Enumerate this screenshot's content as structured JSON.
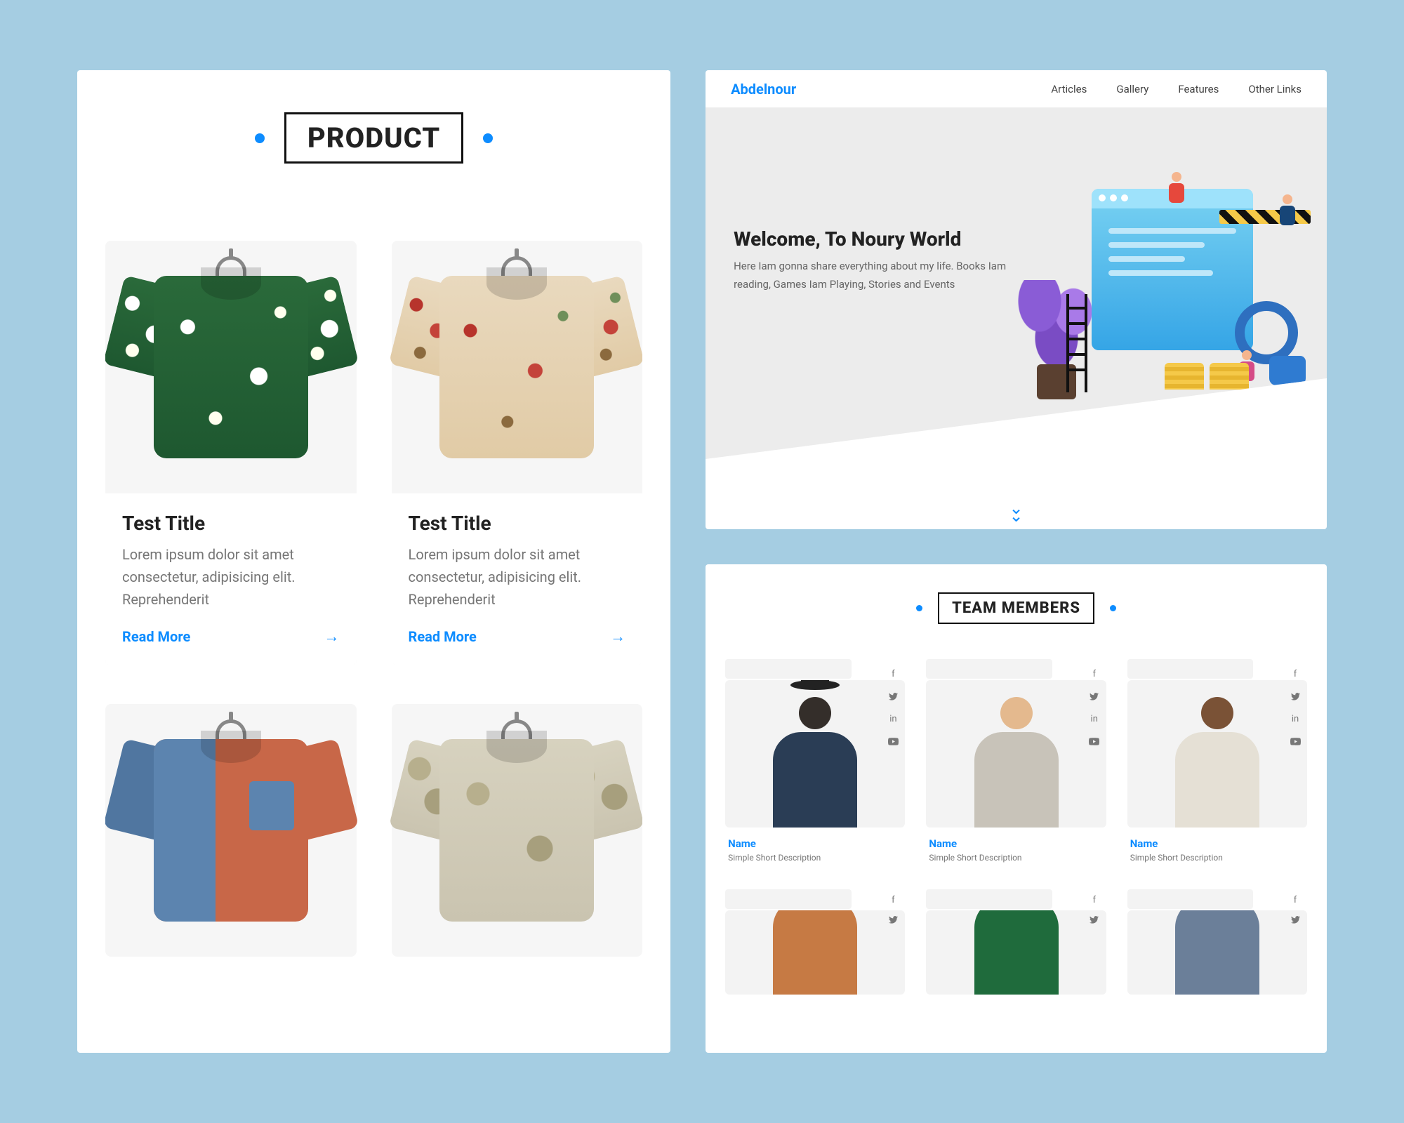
{
  "products": {
    "heading": "PRODUCT",
    "items": [
      {
        "title": "Test Title",
        "desc": "Lorem ipsum dolor sit amet consectetur, adipisicing elit. Reprehenderit",
        "cta": "Read More"
      },
      {
        "title": "Test Title",
        "desc": "Lorem ipsum dolor sit amet consectetur, adipisicing elit. Reprehenderit",
        "cta": "Read More"
      },
      {
        "title": "",
        "desc": "",
        "cta": ""
      },
      {
        "title": "",
        "desc": "",
        "cta": ""
      }
    ]
  },
  "nav": {
    "brand": "Abdelnour",
    "links": [
      "Articles",
      "Gallery",
      "Features",
      "Other Links"
    ]
  },
  "hero": {
    "title": "Welcome, To Noury World",
    "subtitle": "Here Iam gonna share everything about my life. Books Iam reading, Games Iam Playing, Stories and Events"
  },
  "team": {
    "heading": "TEAM MEMBERS",
    "members": [
      {
        "name": "Name",
        "desc": "Simple Short Description"
      },
      {
        "name": "Name",
        "desc": "Simple Short Description"
      },
      {
        "name": "Name",
        "desc": "Simple Short Description"
      },
      {
        "name": "",
        "desc": ""
      },
      {
        "name": "",
        "desc": ""
      },
      {
        "name": "",
        "desc": ""
      }
    ]
  },
  "colors": {
    "accent": "#0d8cff"
  }
}
